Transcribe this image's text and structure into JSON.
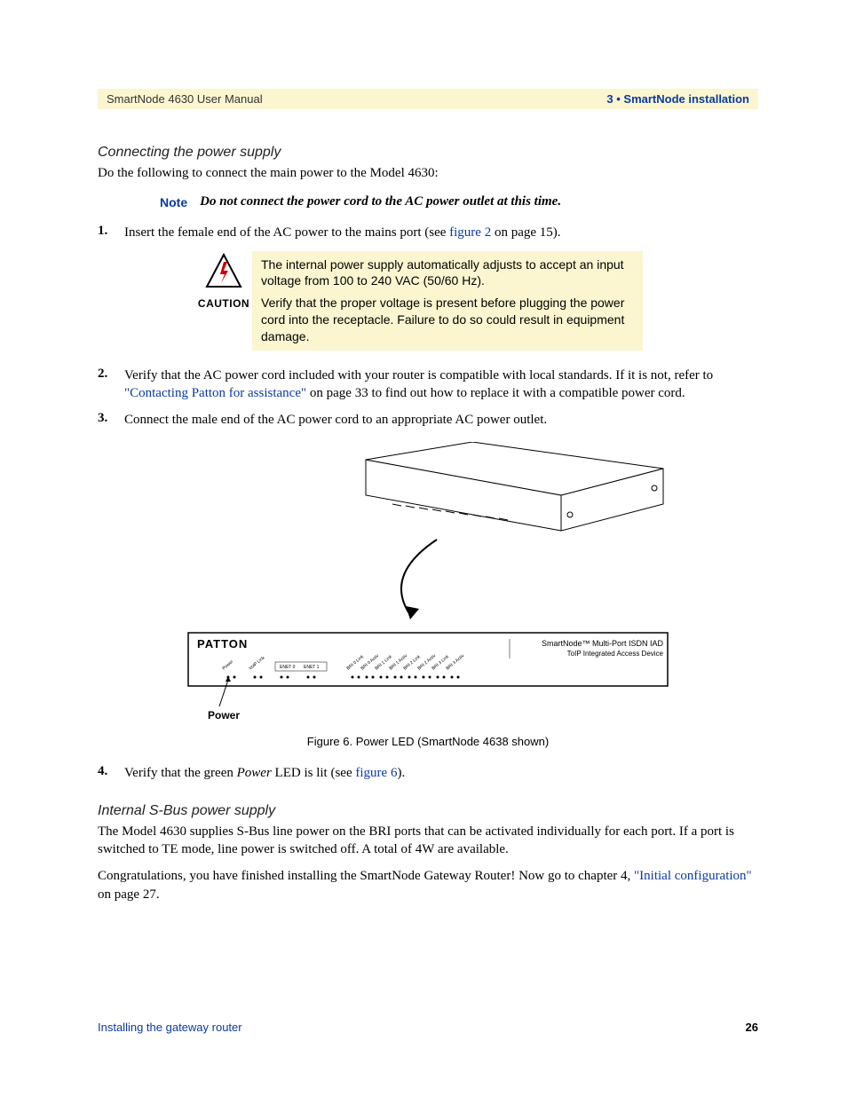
{
  "header": {
    "left": "SmartNode 4630 User Manual",
    "right": "3 • SmartNode installation"
  },
  "section1": {
    "heading": "Connecting the power supply",
    "intro": "Do the following to connect the main power to the Model 4630:"
  },
  "note": {
    "label": "Note",
    "text": "Do not connect the power cord to the AC power outlet at this time."
  },
  "steps": {
    "s1": {
      "num": "1.",
      "prefix": "Insert the female end of the AC power to the mains port (see ",
      "link": "figure 2",
      "suffix": " on page 15)."
    },
    "s2": {
      "num": "2.",
      "prefix": "Verify that the AC power cord included with your router is compatible with local standards. If it is not, refer to ",
      "link": "\"Contacting Patton for assistance\"",
      "suffix": " on page 33 to find out how to replace it with a compatible power cord."
    },
    "s3": {
      "num": "3.",
      "text": "Connect the male end of the AC power cord to an appropriate AC power outlet."
    },
    "s4": {
      "num": "4.",
      "prefix": "Verify that the green ",
      "italic": "Power",
      "mid": " LED is lit (see ",
      "link": "figure 6",
      "suffix": ")."
    }
  },
  "caution": {
    "label": "CAUTION",
    "p1": "The internal power supply automatically adjusts to accept an input voltage from 100 to 240 VAC (50/60 Hz).",
    "p2": "Verify that the proper voltage is present before plugging the power cord into the receptacle. Failure to do so could result in equipment damage."
  },
  "figure": {
    "front_label_left": "PATTON",
    "front_label_right1": "SmartNode™ Multi-Port ISDN IAD",
    "front_label_right2": "ToIP Integrated Access Device",
    "power_pointer": "Power",
    "caption": "Figure 6. Power LED (SmartNode 4638 shown)"
  },
  "section2": {
    "heading": "Internal S-Bus power supply",
    "p1": "The Model 4630 supplies S-Bus line power on the BRI ports that can be activated individually for each port. If a port is switched to TE mode, line power is switched off. A total of 4W are available.",
    "p2_prefix": "Congratulations, you have finished installing the SmartNode Gateway Router! Now go to chapter 4, ",
    "p2_link": "\"Initial configuration\"",
    "p2_suffix": " on page 27."
  },
  "footer": {
    "left": "Installing the gateway router",
    "right": "26"
  }
}
